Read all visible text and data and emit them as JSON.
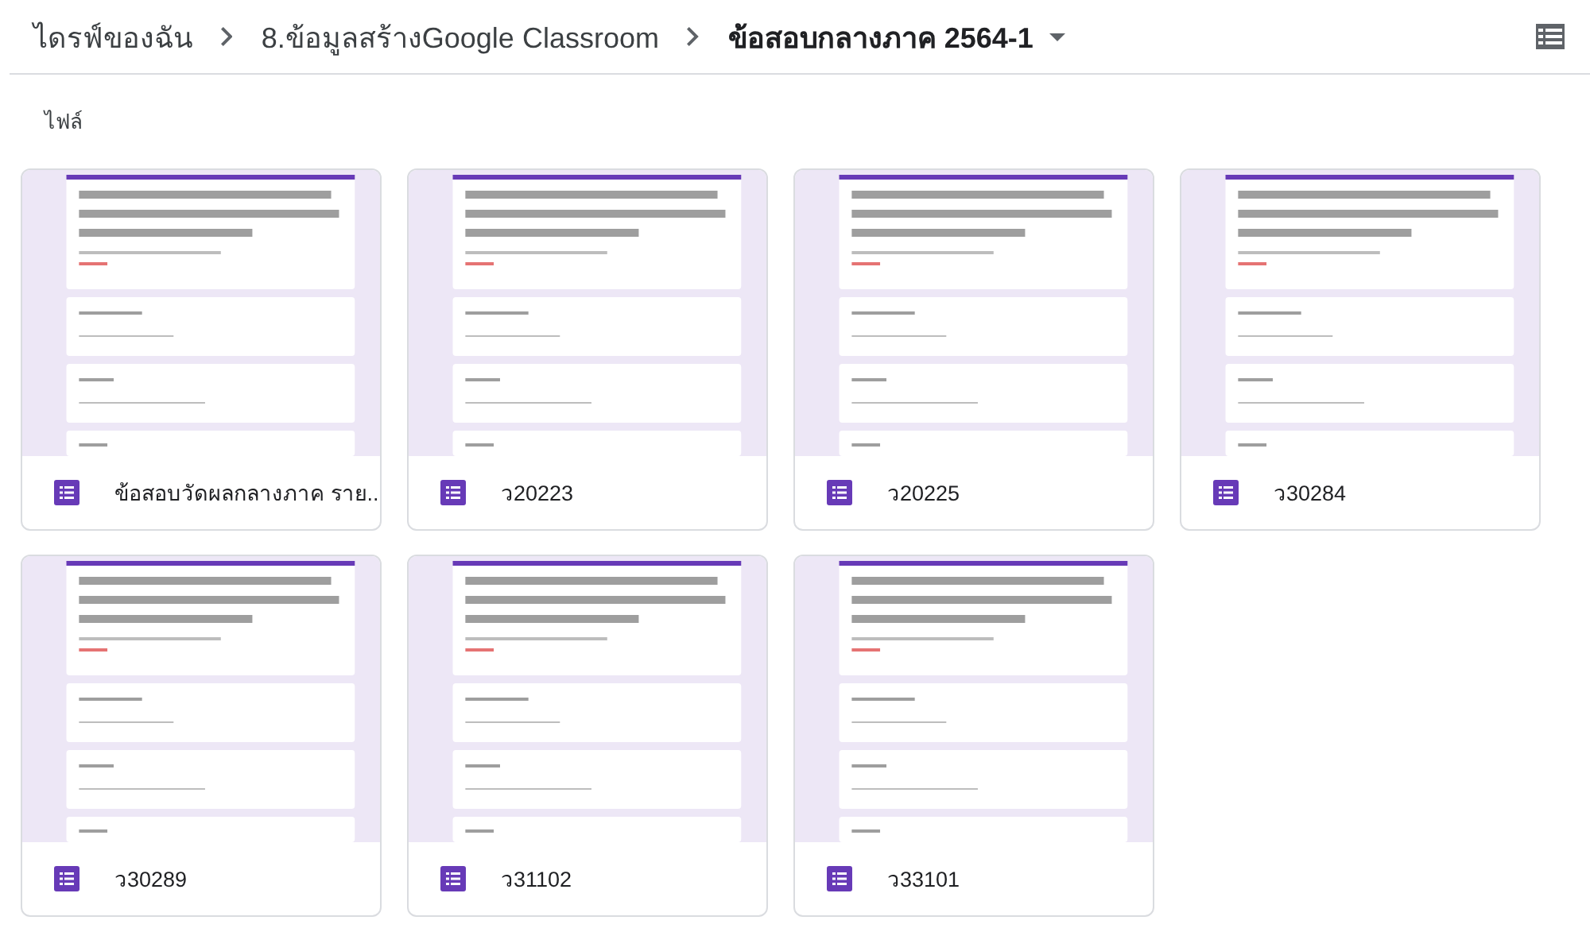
{
  "breadcrumb": [
    {
      "label": "ไดรฟ์ของฉัน",
      "current": false
    },
    {
      "label": "8.ข้อมูลสร้างGoogle Classroom",
      "current": false
    },
    {
      "label": "ข้อสอบกลางภาค 2564-1",
      "current": true
    }
  ],
  "section": "ไฟล์",
  "files": [
    {
      "name": "ข้อสอบวัดผลกลางภาค ราย..."
    },
    {
      "name": "ว20223"
    },
    {
      "name": "ว20225"
    },
    {
      "name": "ว30284"
    },
    {
      "name": "ว30289"
    },
    {
      "name": "ว31102"
    },
    {
      "name": "ว33101"
    }
  ]
}
